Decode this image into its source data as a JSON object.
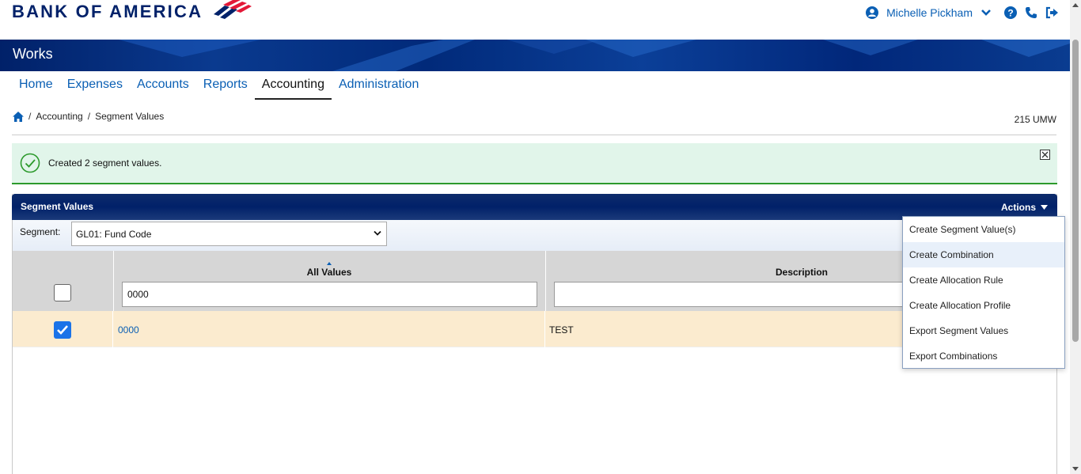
{
  "header": {
    "brand": "BANK OF AMERICA",
    "user_name": "Michelle Pickham"
  },
  "banner": {
    "title": "Works"
  },
  "nav": {
    "items": [
      {
        "label": "Home"
      },
      {
        "label": "Expenses"
      },
      {
        "label": "Accounts"
      },
      {
        "label": "Reports"
      },
      {
        "label": "Accounting"
      },
      {
        "label": "Administration"
      }
    ],
    "active": "Accounting"
  },
  "breadcrumb": {
    "items": [
      "Accounting",
      "Segment Values"
    ],
    "separator": "/"
  },
  "org_code": "215 UMW",
  "alert": {
    "message": "Created 2 segment values."
  },
  "panel": {
    "title": "Segment Values",
    "actions_label": "Actions"
  },
  "segment": {
    "label": "Segment:",
    "selected": "GL01: Fund Code"
  },
  "grid": {
    "columns": [
      "All Values",
      "Description"
    ],
    "filters": {
      "all_values": "0000",
      "description": ""
    },
    "rows": [
      {
        "value": "0000",
        "description": "TEST",
        "checked": true
      }
    ]
  },
  "actions_menu": {
    "items": [
      "Create Segment Value(s)",
      "Create Combination",
      "Create Allocation Rule",
      "Create Allocation Profile",
      "Export Segment Values",
      "Export Combinations"
    ],
    "highlighted": "Create Combination"
  },
  "colors": {
    "brand_navy": "#012169",
    "link_blue": "#0a5fb4",
    "brand_red": "#e31837",
    "success_green": "#2c9a2c",
    "row_highlight": "#fbebcf"
  }
}
